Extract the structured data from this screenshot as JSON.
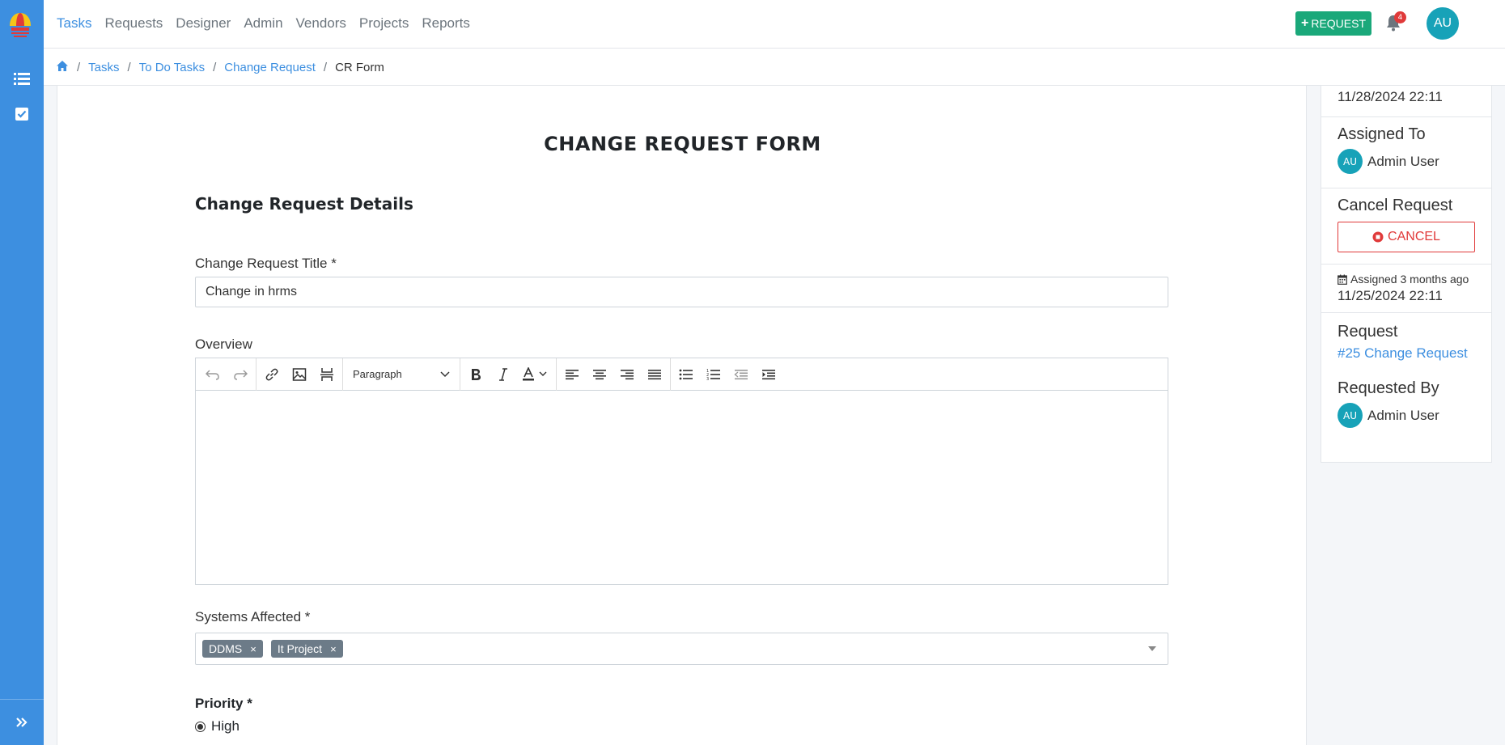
{
  "nav": {
    "links": [
      "Tasks",
      "Requests",
      "Designer",
      "Admin",
      "Vendors",
      "Projects",
      "Reports"
    ],
    "request_button": "REQUEST",
    "notification_count": "4",
    "user_initials": "AU"
  },
  "breadcrumb": {
    "items": [
      "Tasks",
      "To Do Tasks",
      "Change Request"
    ],
    "current": "CR Form"
  },
  "form": {
    "title": "CHANGE REQUEST FORM",
    "section_title": "Change Request Details",
    "cr_title_label": "Change Request Title *",
    "cr_title_value": "Change in hrms",
    "overview_label": "Overview",
    "editor_block_format": "Paragraph",
    "systems_label": "Systems Affected *",
    "systems_tags": [
      "DDMS",
      "It Project"
    ],
    "tag_remove": "×",
    "priority_label": "Priority *",
    "priority_option": "High"
  },
  "right_panel": {
    "top_date": "11/28/2024 22:11",
    "assigned_to_heading": "Assigned To",
    "assigned_to_initials": "AU",
    "assigned_to_name": "Admin User",
    "cancel_heading": "Cancel Request",
    "cancel_button": "CANCEL",
    "assigned_ago": "Assigned 3 months ago",
    "assigned_date": "11/25/2024 22:11",
    "request_heading": "Request",
    "request_link": "#25 Change Request",
    "requested_by_heading": "Requested By",
    "requested_by_initials": "AU",
    "requested_by_name": "Admin User"
  },
  "colors": {
    "primary": "#3d8fe0",
    "success": "#1aa87a",
    "danger": "#e03a3a",
    "avatar": "#17a2b8",
    "tag": "#6c7b88"
  }
}
